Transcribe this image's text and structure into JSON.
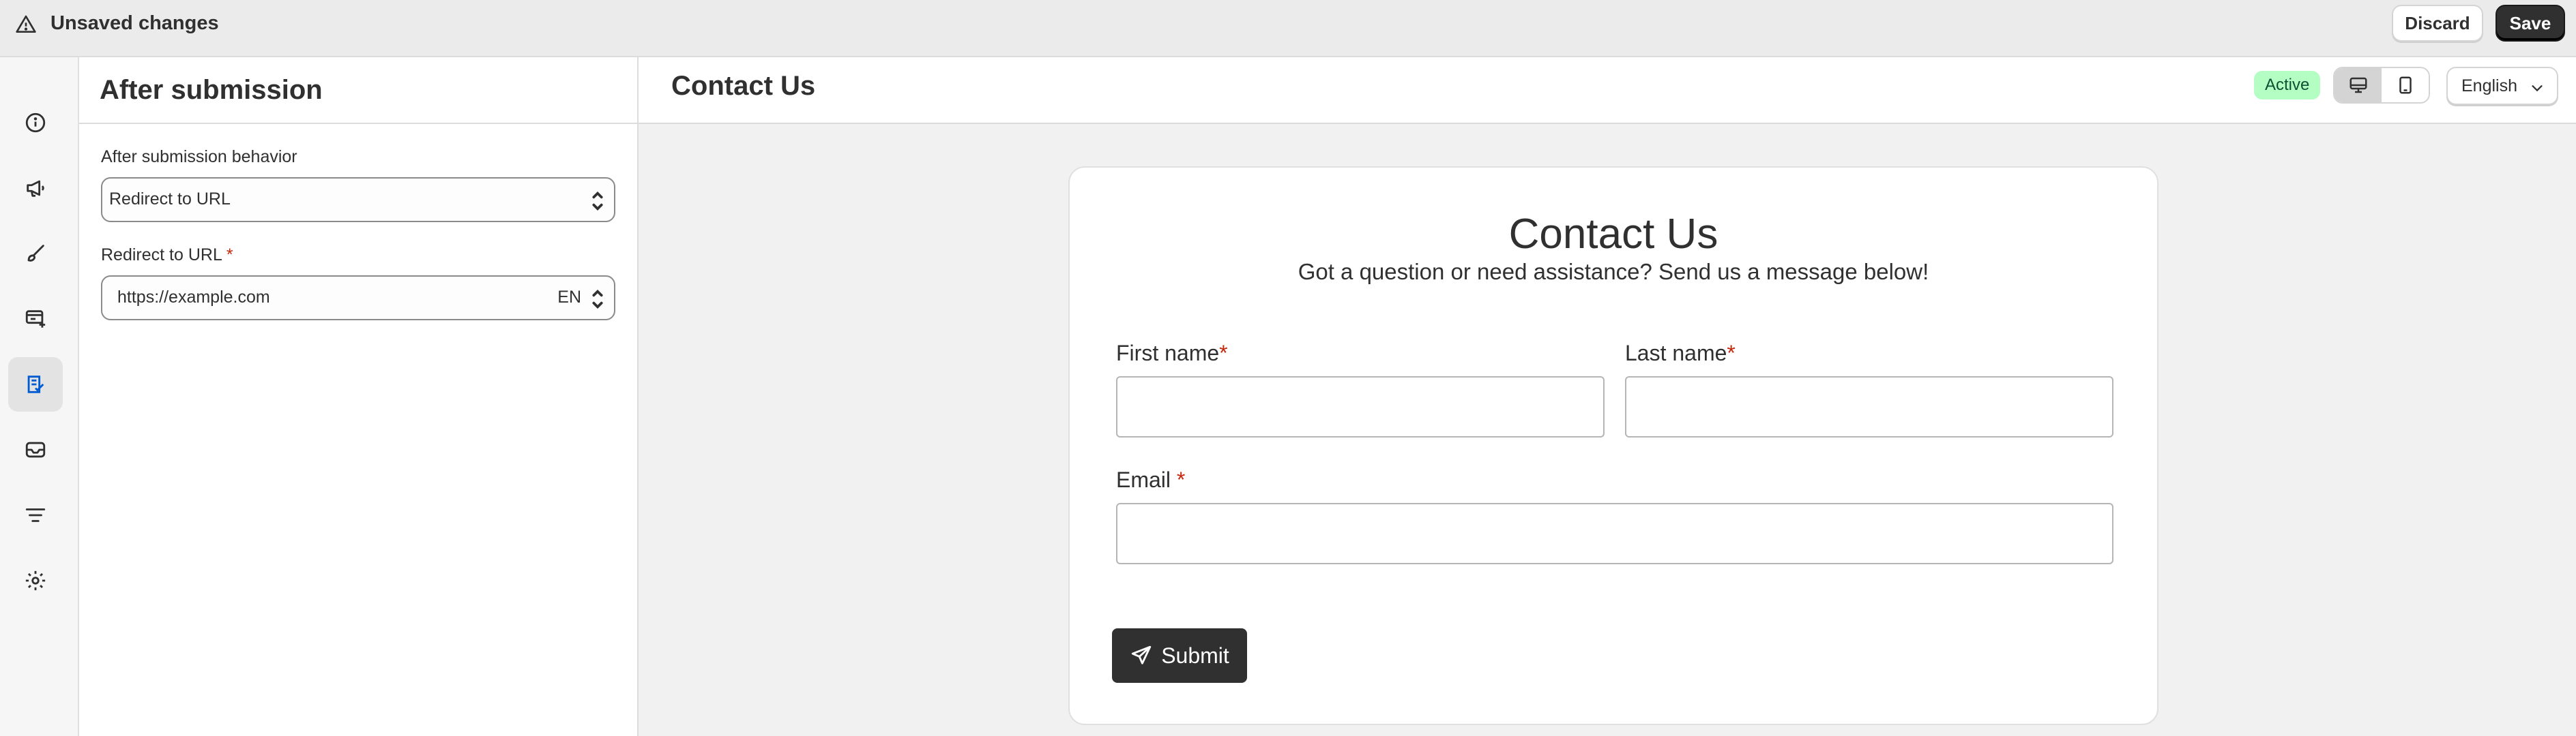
{
  "topbar": {
    "icon": "alert-triangle-icon",
    "title": "Unsaved changes",
    "discard_label": "Discard",
    "save_label": "Save"
  },
  "rail": {
    "items": [
      {
        "icon": "info-icon"
      },
      {
        "icon": "megaphone-icon"
      },
      {
        "icon": "brush-icon"
      },
      {
        "icon": "form-add-icon"
      },
      {
        "icon": "form-submission-icon",
        "active": true
      },
      {
        "icon": "mail-icon"
      },
      {
        "icon": "filter-icon"
      },
      {
        "icon": "gear-icon"
      }
    ]
  },
  "panel": {
    "title": "After submission",
    "behavior_label": "After submission behavior",
    "behavior_value": "Redirect to URL",
    "url_label": "Redirect to URL",
    "url_required": "*",
    "url_value": "https://example.com",
    "url_lang": "EN"
  },
  "main": {
    "title": "Contact Us",
    "status_badge": "Active",
    "view_modes": [
      "desktop-icon",
      "mobile-icon"
    ],
    "selected_view": "desktop-icon",
    "language": "English"
  },
  "form": {
    "title": "Contact Us",
    "subtitle": "Got a question or need assistance? Send us a message below!",
    "first_name_label": "First name",
    "last_name_label": "Last name",
    "email_label": "Email ",
    "required_mark": "*",
    "submit_label": "Submit",
    "submit_icon": "send-icon"
  },
  "colors": {
    "accent_dark": "#303030",
    "active_badge_bg": "#b4fec4",
    "required": "#c5280c",
    "active_rail_icon": "#005bd3"
  }
}
